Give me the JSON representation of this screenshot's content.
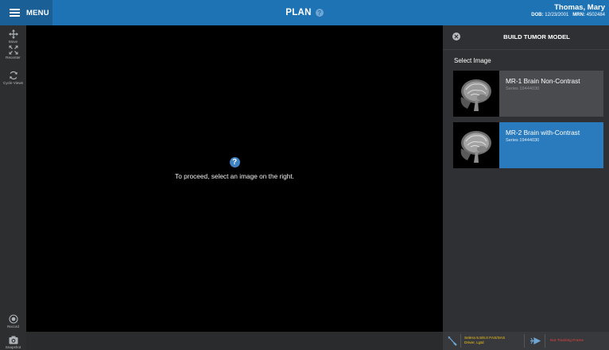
{
  "header": {
    "menu_label": "MENU",
    "title": "PLAN",
    "help_glyph": "?",
    "patient_name": "Thomas, Mary",
    "dob_label": "DOB:",
    "dob": "12/23/2001",
    "mrn_label": "MRN:",
    "mrn": "4502484",
    "bar_color": "#1e73b4"
  },
  "toolbar": {
    "tools": [
      {
        "label": "Move",
        "icon": "move-icon"
      },
      {
        "label": "Recenter",
        "icon": "recenter-icon"
      },
      {
        "label": "Cycle Views",
        "icon": "cycle-views-icon"
      },
      {
        "label": "Record",
        "icon": "record-icon"
      },
      {
        "label": "Snapshot",
        "icon": "snapshot-icon"
      }
    ]
  },
  "viewer": {
    "help_glyph": "?",
    "message": "To proceed, select an image on the right."
  },
  "panel": {
    "close_glyph": "✕",
    "title": "BUILD TUMOR MODEL",
    "select_label": "Select Image",
    "images": [
      {
        "name": "MR-1 Brain Non-Contrast",
        "series": "Series 19444030",
        "selected": false
      },
      {
        "name": "MR-2 Brain with-Contrast",
        "series": "Series 19444030",
        "selected": true
      }
    ],
    "accent": "#2a7bbd"
  },
  "footer": {
    "device_line1": "Selera 5.5/6.0 FAS/SAS",
    "device_line2": "Driver, Lgtd",
    "tracker_text": "Not Tracking Frame",
    "device_color": "#f5c518",
    "tracker_color": "#e8413c"
  }
}
